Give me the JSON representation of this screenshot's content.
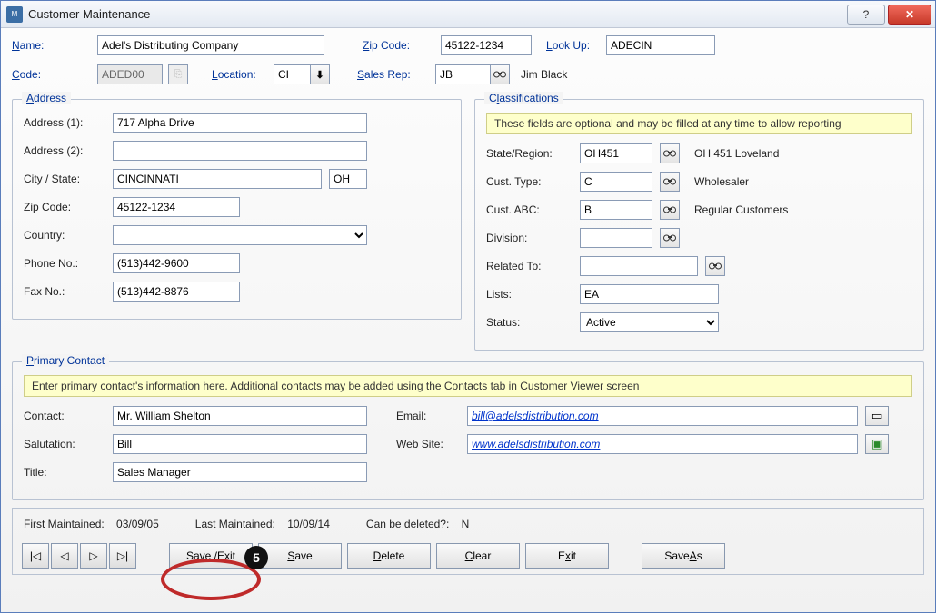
{
  "window": {
    "title": "Customer Maintenance"
  },
  "top": {
    "name_label": "Name:",
    "name_value": "Adel's Distributing Company",
    "zip_label": "Zip Code:",
    "zip_value": "45122-1234",
    "lookup_label": "Look Up:",
    "lookup_value": "ADECIN",
    "code_label": "Code:",
    "code_value": "ADED00",
    "location_label": "Location:",
    "location_value": "CI",
    "salesrep_label": "Sales Rep:",
    "salesrep_value": "JB",
    "salesrep_name": "Jim Black"
  },
  "address": {
    "legend": "Address",
    "addr1_label": "Address (1):",
    "addr1_value": "717 Alpha Drive",
    "addr2_label": "Address (2):",
    "addr2_value": "",
    "citystate_label": "City / State:",
    "city_value": "CINCINNATI",
    "state_value": "OH",
    "zip_label": "Zip Code:",
    "zip_value": "45122-1234",
    "country_label": "Country:",
    "country_value": "",
    "phone_label": "Phone No.:",
    "phone_value": "(513)442-9600",
    "fax_label": "Fax No.:",
    "fax_value": "(513)442-8876"
  },
  "class": {
    "legend": "Classifications",
    "info": "These fields are optional and may be filled at any time to allow reporting",
    "stateregion_label": "State/Region:",
    "stateregion_value": "OH451",
    "stateregion_desc": "OH 451 Loveland",
    "custtype_label": "Cust. Type:",
    "custtype_value": "C",
    "custtype_desc": "Wholesaler",
    "custabc_label": "Cust. ABC:",
    "custabc_value": "B",
    "custabc_desc": "Regular Customers",
    "division_label": "Division:",
    "division_value": "",
    "related_label": "Related To:",
    "related_value": "",
    "lists_label": "Lists:",
    "lists_value": "EA",
    "status_label": "Status:",
    "status_value": "Active"
  },
  "contact": {
    "legend": "Primary Contact",
    "info": "Enter primary contact's information here. Additional contacts may be added using the Contacts tab in Customer Viewer screen",
    "contact_label": "Contact:",
    "contact_value": "Mr. William Shelton",
    "salutation_label": "Salutation:",
    "salutation_value": "Bill",
    "title_label": "Title:",
    "title_value": "Sales Manager",
    "email_label": "Email:",
    "email_value": "bill@adelsdistribution.com",
    "website_label": "Web Site:",
    "website_value": "www.adelsdistribution.com"
  },
  "footer": {
    "first_label": "First Maintained:",
    "first_value": "03/09/05",
    "last_label": "Last Maintained:",
    "last_value": "10/09/14",
    "candelete_label": "Can be deleted?:",
    "candelete_value": "N",
    "btn_saveexit": "Save / Exit",
    "btn_save": "Save",
    "btn_delete": "Delete",
    "btn_clear": "Clear",
    "btn_exit": "Exit",
    "btn_saveas": "Save As"
  },
  "annotation": {
    "step": "5"
  }
}
